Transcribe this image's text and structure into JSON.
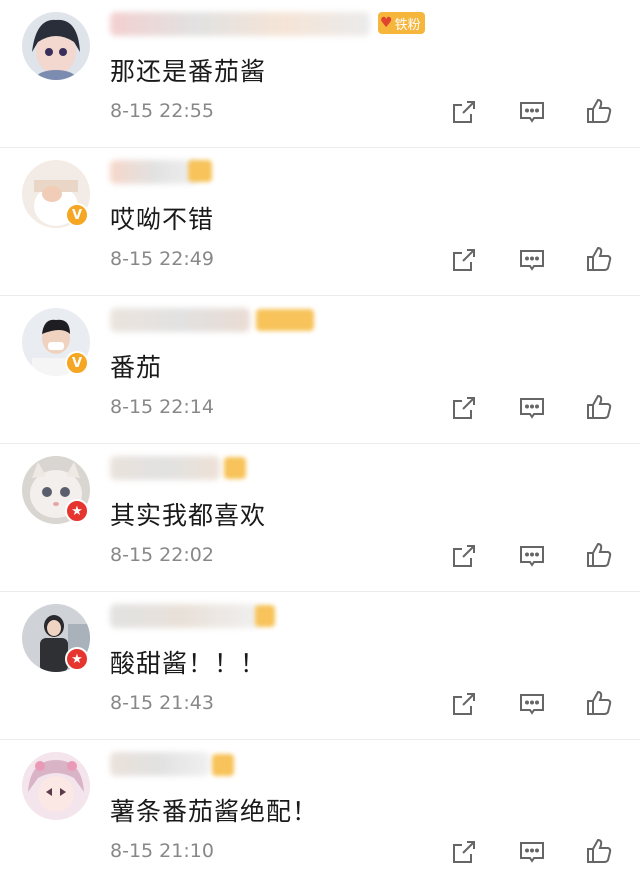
{
  "fan_badge": {
    "label": "铁粉",
    "icon": "heart-icon"
  },
  "comments": [
    {
      "text": "那还是番茄酱",
      "time": "8-15 22:55",
      "badge": "none"
    },
    {
      "text": "哎呦不错",
      "time": "8-15 22:49",
      "badge": "v"
    },
    {
      "text": "番茄",
      "time": "8-15 22:14",
      "badge": "v"
    },
    {
      "text": "其实我都喜欢",
      "time": "8-15 22:02",
      "badge": "star"
    },
    {
      "text": "酸甜酱！！！",
      "time": "8-15 21:43",
      "badge": "star"
    },
    {
      "text": "薯条番茄酱绝配！",
      "time": "8-15 21:10",
      "badge": "none"
    }
  ],
  "actions": [
    "share-icon",
    "comment-icon",
    "like-icon"
  ],
  "colors": {
    "accent": "#f5a623",
    "star_badge": "#e6352e",
    "time_text": "#888888"
  }
}
